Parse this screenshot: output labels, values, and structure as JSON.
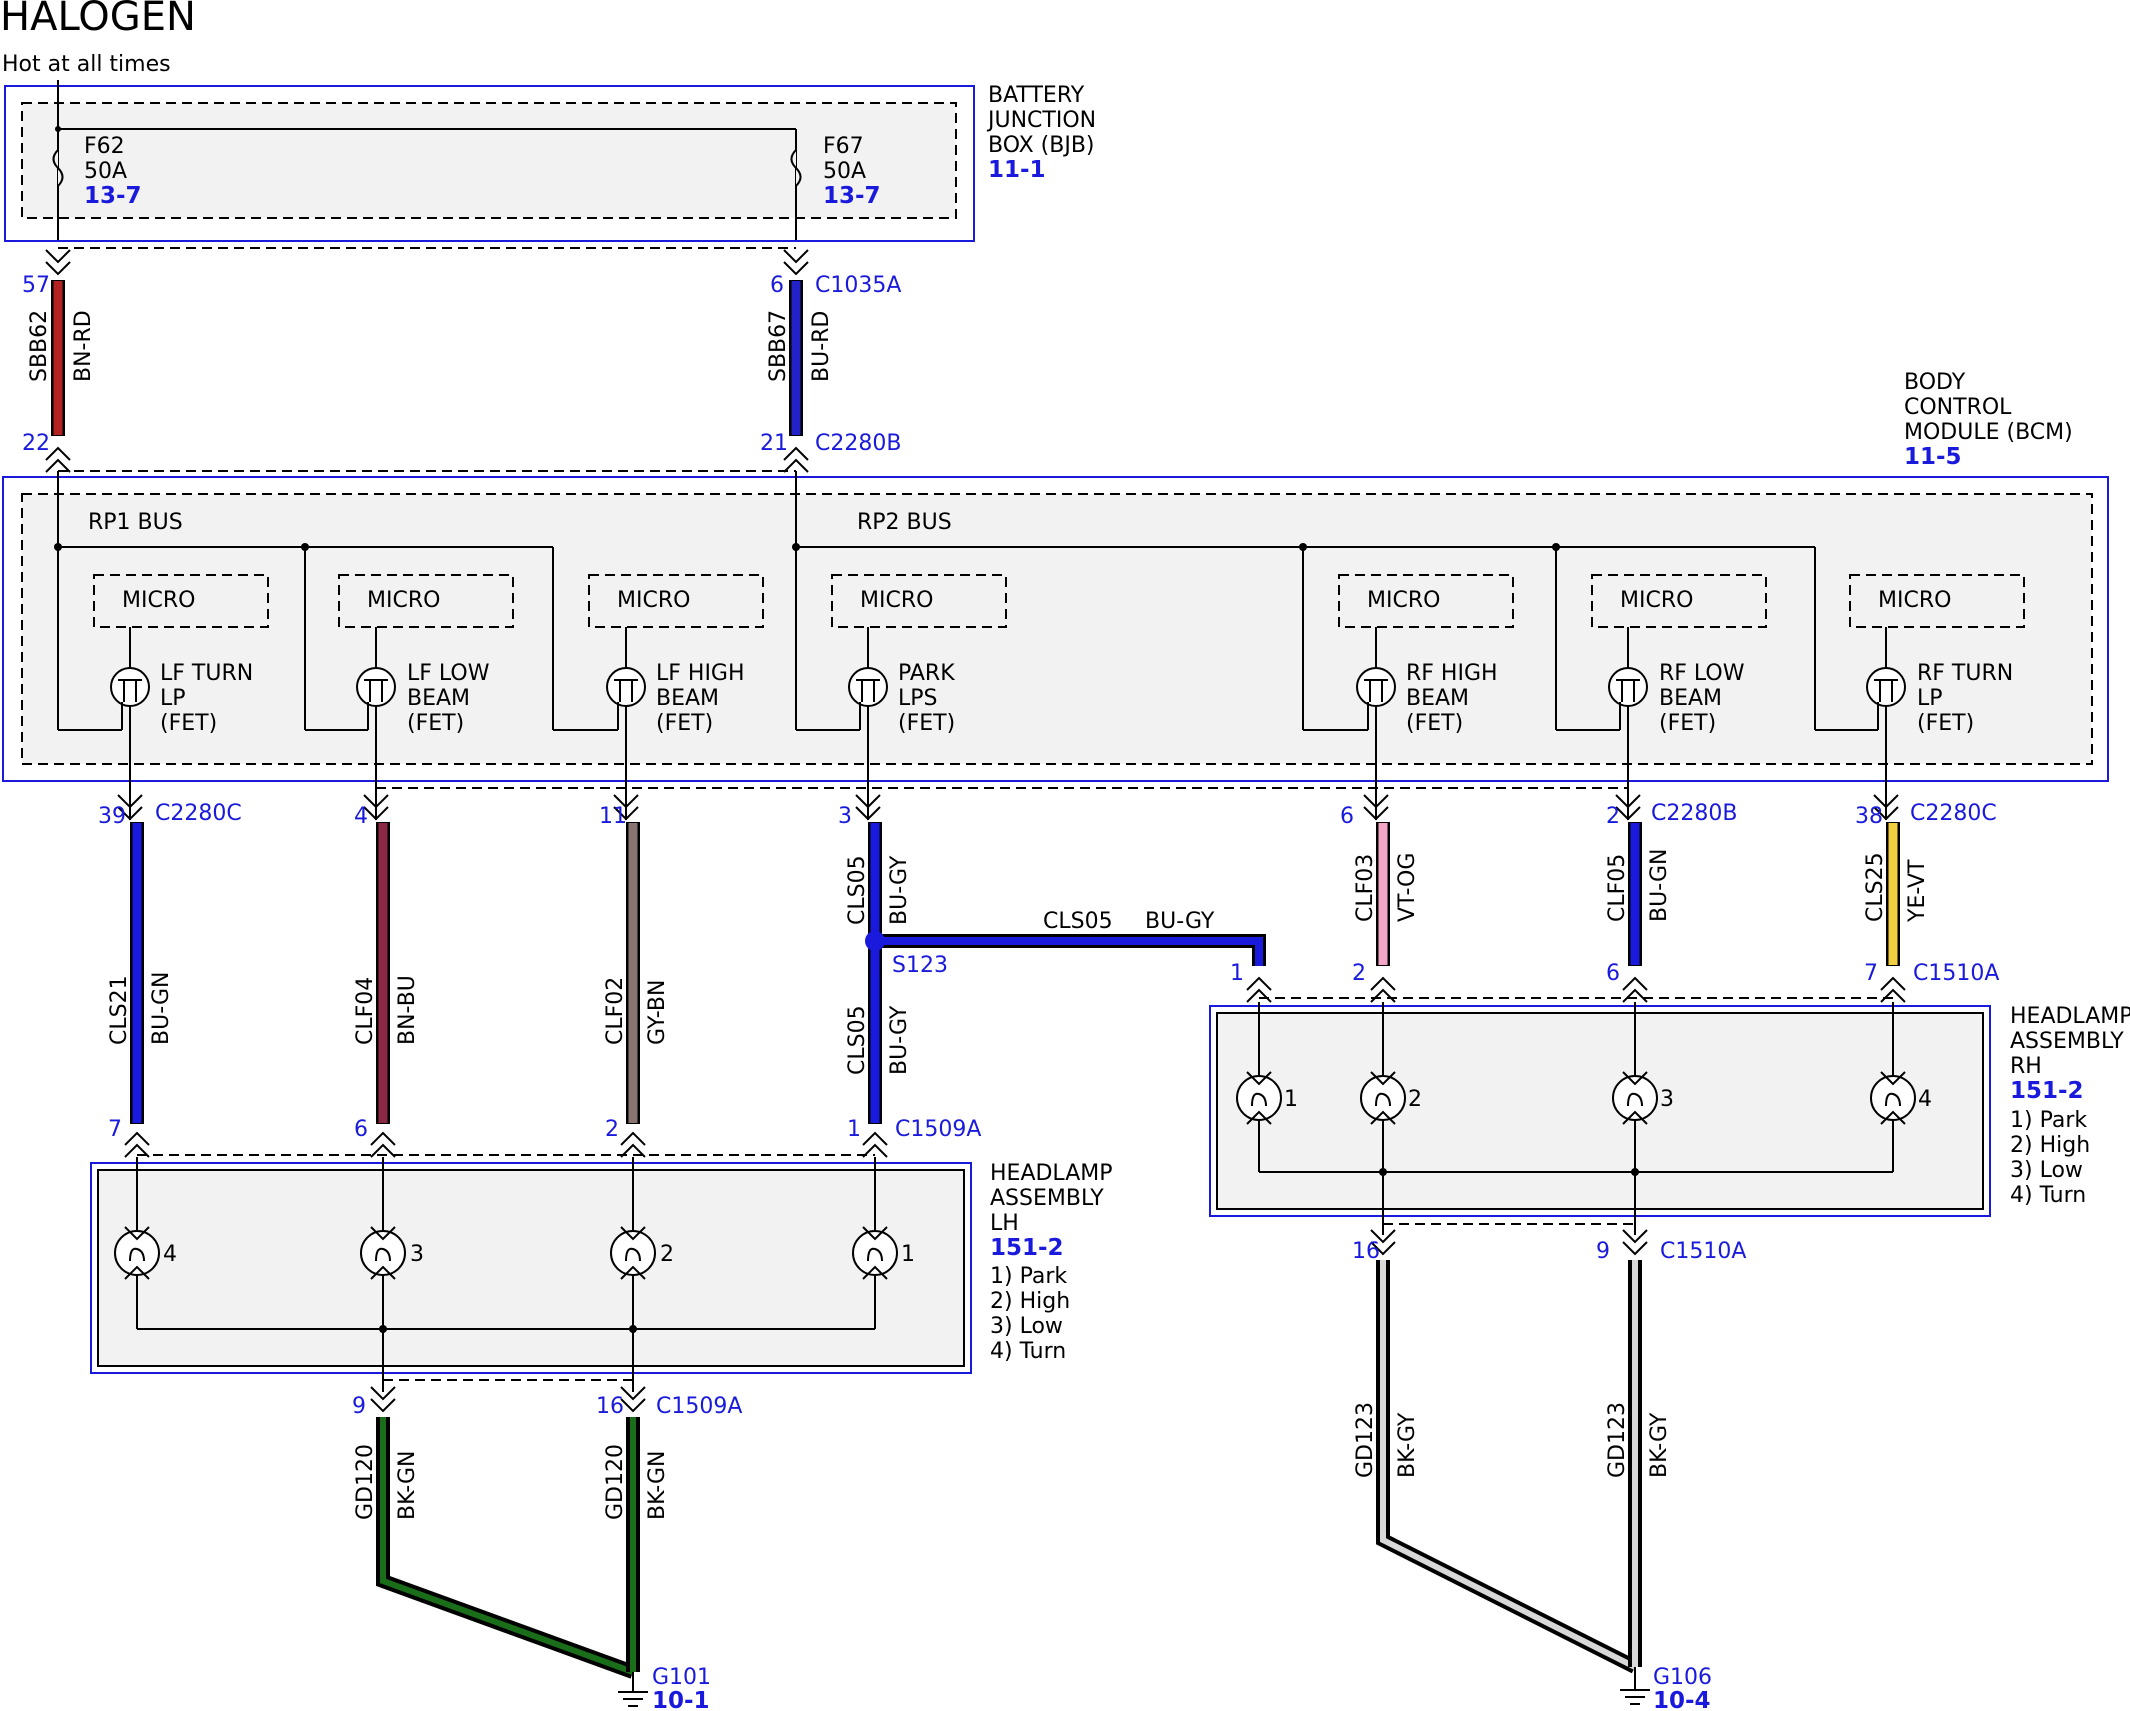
{
  "title": "HALOGEN",
  "hot_note": "Hot at all times",
  "bjb": {
    "name_lines": [
      "BATTERY",
      "JUNCTION",
      "BOX (BJB)"
    ],
    "ref": "11-1",
    "fuses": [
      {
        "id": "F62",
        "rating": "50A",
        "ref": "13-7"
      },
      {
        "id": "F67",
        "rating": "50A",
        "ref": "13-7"
      }
    ]
  },
  "bcm": {
    "name_lines": [
      "BODY",
      "CONTROL",
      "MODULE (BCM)"
    ],
    "ref": "11-5",
    "bus_labels": [
      "RP1 BUS",
      "RP2 BUS"
    ],
    "micro_label": "MICRO",
    "fets": [
      {
        "lines": [
          "LF TURN",
          "LP",
          "(FET)"
        ]
      },
      {
        "lines": [
          "LF LOW",
          "BEAM",
          "(FET)"
        ]
      },
      {
        "lines": [
          "LF HIGH",
          "BEAM",
          "(FET)"
        ]
      },
      {
        "lines": [
          "PARK",
          "LPS",
          "(FET)"
        ]
      },
      {
        "lines": [
          "RF HIGH",
          "BEAM",
          "(FET)"
        ]
      },
      {
        "lines": [
          "RF LOW",
          "BEAM",
          "(FET)"
        ]
      },
      {
        "lines": [
          "RF TURN",
          "LP",
          "(FET)"
        ]
      }
    ]
  },
  "feed_wires": [
    {
      "circuit": "SBB62",
      "color_code": "BN-RD",
      "pin_top": "57",
      "pin_bottom": "22",
      "connector_top": "",
      "connector_bottom": "",
      "color": "#b22222"
    },
    {
      "circuit": "SBB67",
      "color_code": "BU-RD",
      "pin_top": "6",
      "pin_bottom": "21",
      "connector_top": "C1035A",
      "connector_bottom": "C2280B",
      "color": "#2222c8"
    }
  ],
  "output_wires": [
    {
      "circuit": "CLS21",
      "color_code": "BU-GN",
      "pin_top": "39",
      "connector_top": "C2280C",
      "pin_bottom": "7",
      "connector_bottom": "",
      "color": "#1a1adc"
    },
    {
      "circuit": "CLF04",
      "color_code": "BN-BU",
      "pin_top": "4",
      "connector_top": "",
      "pin_bottom": "6",
      "connector_bottom": "",
      "color": "#8b2846"
    },
    {
      "circuit": "CLF02",
      "color_code": "GY-BN",
      "pin_top": "11",
      "connector_top": "",
      "pin_bottom": "2",
      "connector_bottom": "",
      "color": "#8a7470"
    },
    {
      "circuit": "CLS05",
      "color_code": "BU-GY",
      "pin_top": "3",
      "connector_top": "",
      "pin_bottom": "1",
      "connector_bottom": "C1509A",
      "color": "#1a1adc"
    },
    {
      "circuit": "CLF03",
      "color_code": "VT-OG",
      "pin_top": "6",
      "connector_top": "",
      "pin_bottom": "2",
      "connector_bottom": "",
      "color": "#f4a6c8"
    },
    {
      "circuit": "CLF05",
      "color_code": "BU-GN",
      "pin_top": "2",
      "connector_top": "C2280B",
      "pin_bottom": "6",
      "connector_bottom": "",
      "color": "#1a1adc"
    },
    {
      "circuit": "CLS25",
      "color_code": "YE-VT",
      "pin_top": "38",
      "connector_top": "C2280C",
      "pin_bottom": "7",
      "connector_bottom": "C1510A",
      "color": "#f0d040"
    }
  ],
  "splice": {
    "id": "S123",
    "branch_circuit": "CLS05",
    "branch_color_code": "BU-GY",
    "branch_lower_circuit": "CLS05",
    "branch_lower_color_code": "BU-GY",
    "rh_pin": "1"
  },
  "headlamp_lh": {
    "name_lines": [
      "HEADLAMP",
      "ASSEMBLY",
      "LH"
    ],
    "ref": "151-2",
    "legend": [
      "1) Park",
      "2) High",
      "3) Low",
      "4) Turn"
    ],
    "bulbs": [
      "4",
      "3",
      "2",
      "1"
    ]
  },
  "headlamp_rh": {
    "name_lines": [
      "HEADLAMP",
      "ASSEMBLY",
      "RH"
    ],
    "ref": "151-2",
    "legend": [
      "1) Park",
      "2) High",
      "3) Low",
      "4) Turn"
    ],
    "bulbs": [
      "1",
      "2",
      "3",
      "4"
    ]
  },
  "ground_lh": {
    "wires": [
      {
        "circuit": "GD120",
        "color_code": "BK-GN",
        "pin": "9"
      },
      {
        "circuit": "GD120",
        "color_code": "BK-GN",
        "pin": "16"
      }
    ],
    "connector": "C1509A",
    "ground_id": "G101",
    "ref": "10-1",
    "color": "#1a6e1a"
  },
  "ground_rh": {
    "wires": [
      {
        "circuit": "GD123",
        "color_code": "BK-GY",
        "pin": "16"
      },
      {
        "circuit": "GD123",
        "color_code": "BK-GY",
        "pin": "9"
      }
    ],
    "connector": "C1510A",
    "ground_id": "G106",
    "ref": "10-4",
    "color": "#d8d8d8"
  }
}
